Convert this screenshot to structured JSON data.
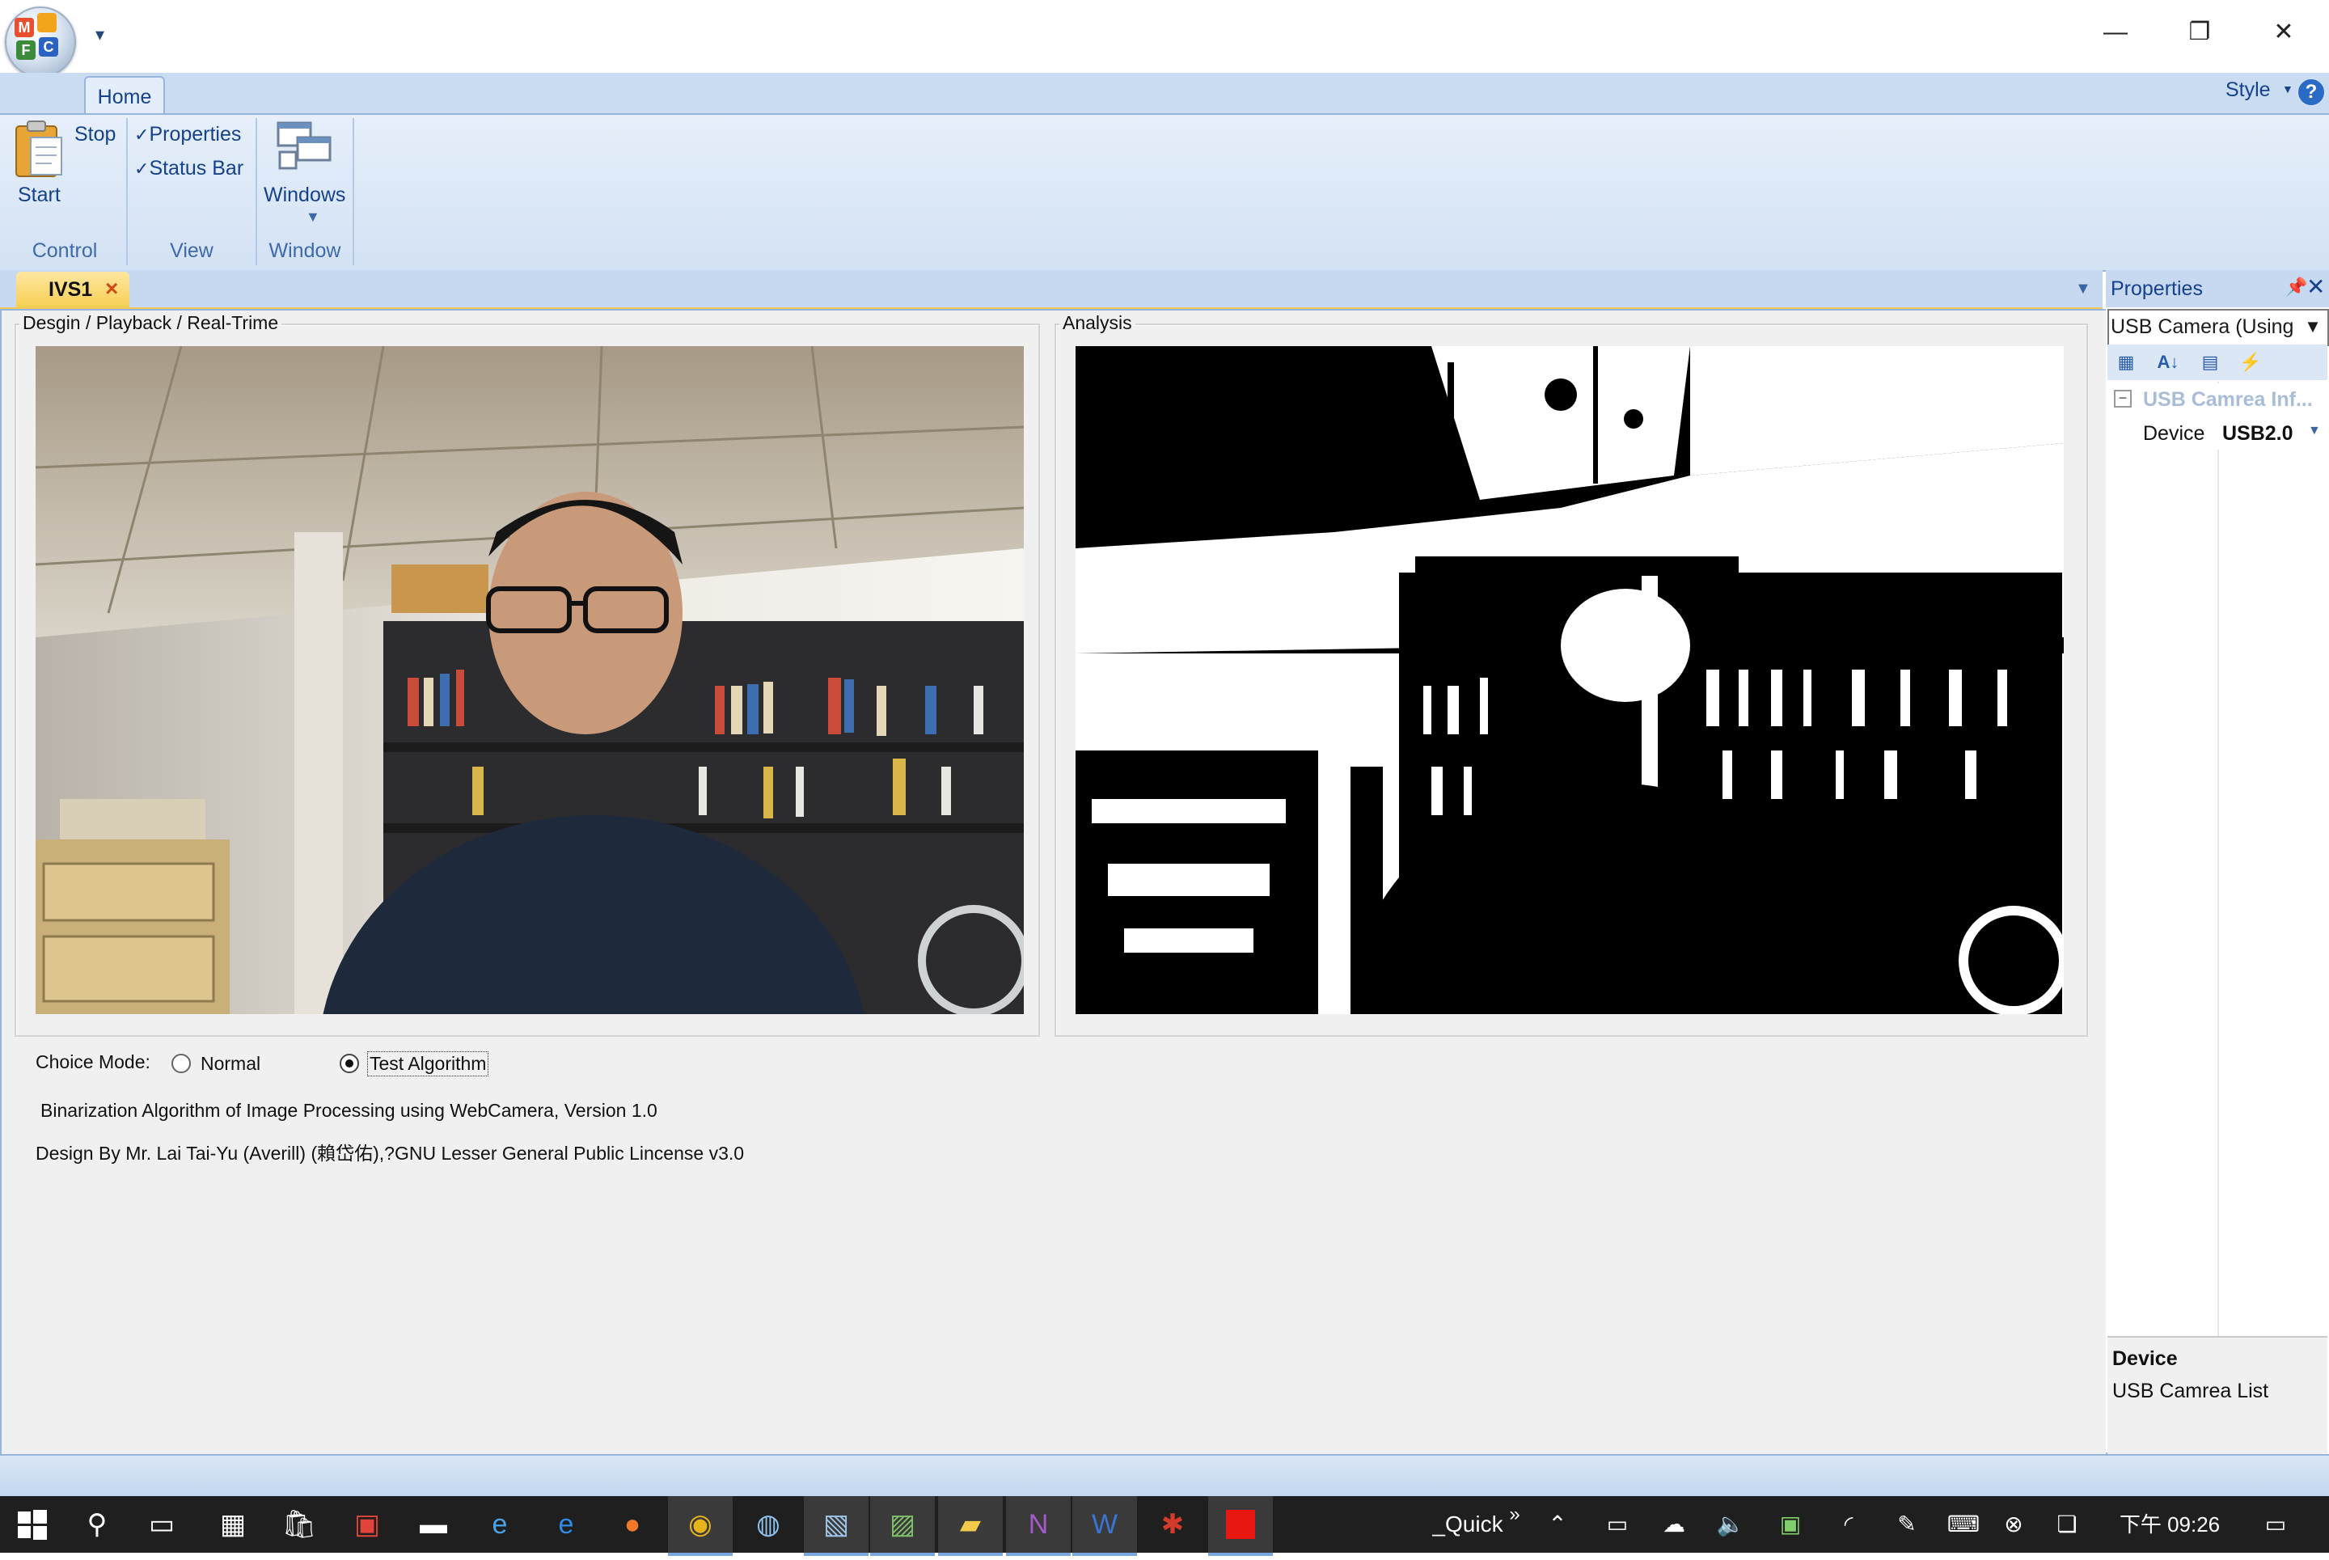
{
  "window": {
    "minimize_glyph": "—",
    "restore_glyph": "❐",
    "close_glyph": "✕"
  },
  "ribbon": {
    "tab_home": "Home",
    "style_label": "Style",
    "control": {
      "start": "Start",
      "stop": "Stop",
      "group_label": "Control"
    },
    "view": {
      "properties": "Properties",
      "status_bar": "Status Bar",
      "properties_checked": true,
      "status_bar_checked": true,
      "group_label": "View"
    },
    "window": {
      "windows": "Windows",
      "group_label": "Window"
    }
  },
  "document_tab": {
    "label": "IVS1"
  },
  "main": {
    "left_group_title": "Desgin / Playback / Real-Trime",
    "right_group_title": "Analysis",
    "choice_mode_label": "Choice Mode:",
    "mode_normal": "Normal",
    "mode_test": "Test Algorithm",
    "selected_mode": "Test Algorithm",
    "info_line1": "Binarization Algorithm of Image Processing using WebCamera, Version 1.0",
    "info_line2": "Design By Mr. Lai Tai-Yu (Averill) (賴岱佑),?GNU Lesser General Public Lincense v3.0"
  },
  "properties": {
    "title": "Properties",
    "combo_value": "USB Camera (Using",
    "category": "USB Camrea Inf...",
    "row_name": "Device",
    "row_value": "USB2.0",
    "desc_title": "Device",
    "desc_text": "USB Camrea List"
  },
  "taskbar": {
    "quick_label": "_Quick",
    "overflow_glyph": "»",
    "clock": "下午 09:26"
  },
  "colors": {
    "ribbon_blue": "#15428b",
    "tab_active": "#f8cf55",
    "close_red": "#d04a18",
    "taskbar": "#1f1f1f"
  }
}
